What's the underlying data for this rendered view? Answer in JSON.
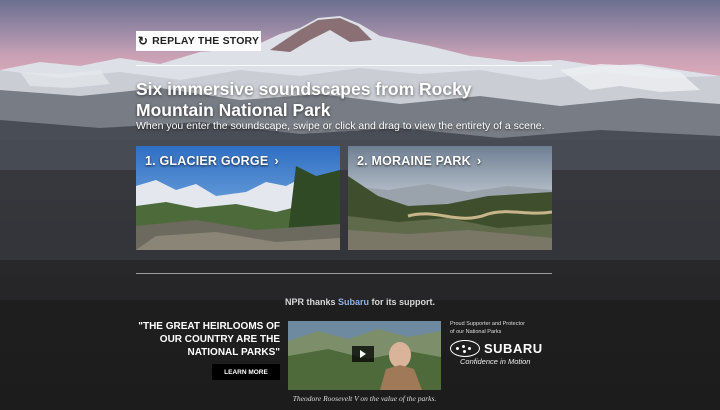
{
  "story": {
    "replay_label": "REPLAY THE STORY",
    "replay_icon": "replay-icon",
    "headline": "Six immersive soundscapes from Rocky Mountain National Park",
    "subline": "When you enter the soundscape, swipe or click and drag to view the entirety of a scene."
  },
  "scenes": [
    {
      "label": "1. GLACIER GORGE",
      "icon": "chevron-right-icon"
    },
    {
      "label": "2. MORAINE PARK",
      "icon": "chevron-right-icon"
    }
  ],
  "sponsor": {
    "thanks_prefix": "NPR thanks ",
    "sponsor_name": "Subaru",
    "thanks_suffix": " for its support.",
    "quote": "\"THE GREAT HEIRLOOMS OF OUR COUNTRY ARE THE NATIONAL PARKS\"",
    "learn_more": "LEARN MORE",
    "video_caption": "Theodore Roosevelt V on the value of the parks.",
    "proud_line1": "Proud Supporter and Protector",
    "proud_line2": "of our National Parks",
    "brand": "SUBARU",
    "tagline": "Confidence in Motion",
    "link_color": "#8fb3e8"
  }
}
